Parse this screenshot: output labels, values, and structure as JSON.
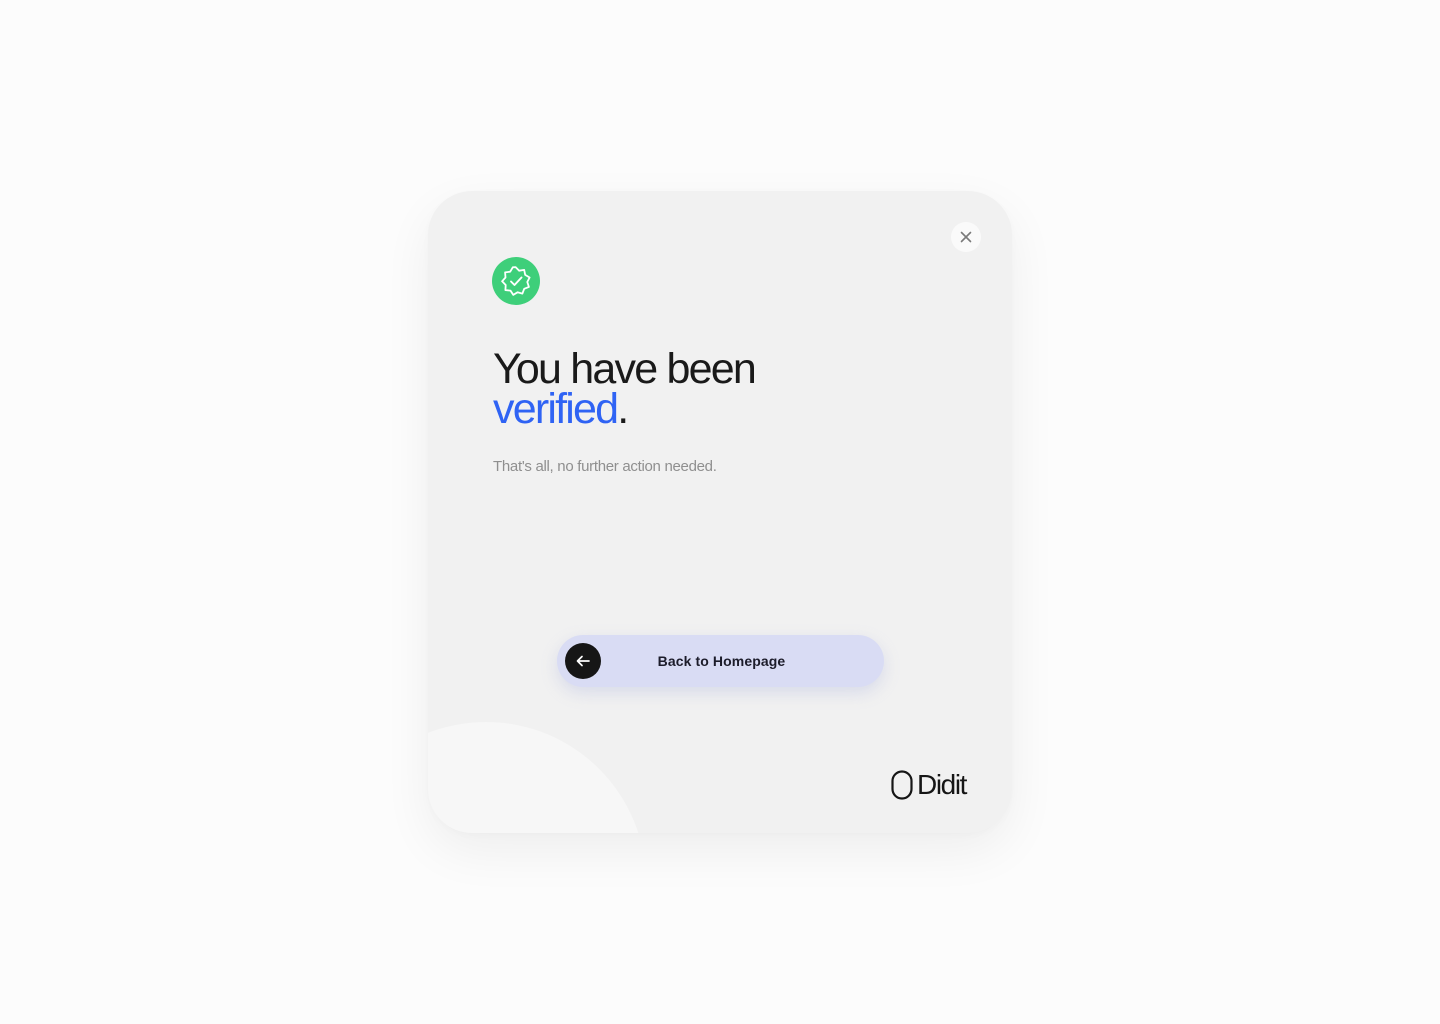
{
  "dialog": {
    "close_icon": "close-icon",
    "status_icon": "verified-badge-icon",
    "headline_line1": "You have been",
    "headline_accent": "verified",
    "headline_period": ".",
    "subtitle": "That's all, no further action needed.",
    "button_label": "Back to Homepage",
    "button_icon": "arrow-left-icon",
    "brand_name": "Didit"
  },
  "colors": {
    "background": "#fcfcfc",
    "card": "#f1f1f1",
    "success_green": "#3ecf7a",
    "accent_blue": "#2f63f4",
    "button_bg": "#d9dcf4",
    "text_dark": "#1a1a1a",
    "text_muted": "#8f8f8f"
  }
}
